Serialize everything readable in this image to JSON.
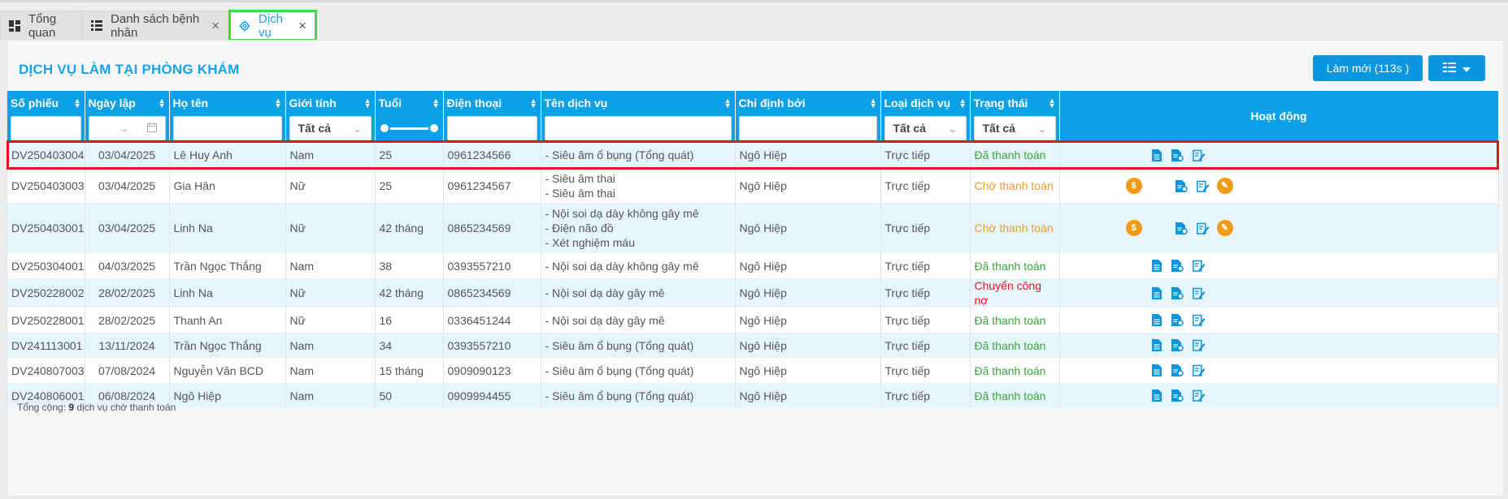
{
  "tabs": [
    {
      "label": "Tổng quan",
      "icon": "dashboard-icon",
      "closable": false
    },
    {
      "label": "Danh sách bệnh nhân",
      "icon": "list-icon",
      "closable": true
    },
    {
      "label": "Dịch vụ",
      "icon": "gear-icon",
      "closable": true,
      "active": true
    }
  ],
  "panel": {
    "title": "DỊCH VỤ LÀM TẠI PHÒNG KHÁM",
    "refresh_label": "Làm mới (113s )"
  },
  "columns": [
    {
      "label": "Số phiếu",
      "filter": "text"
    },
    {
      "label": "Ngày lập",
      "filter": "daterange"
    },
    {
      "label": "Họ tên",
      "filter": "text"
    },
    {
      "label": "Giới tính",
      "filter": "select",
      "value": "Tất cả"
    },
    {
      "label": "Tuổi",
      "filter": "range"
    },
    {
      "label": "Điện thoại",
      "filter": "text"
    },
    {
      "label": "Tên dịch vụ",
      "filter": "text"
    },
    {
      "label": "Chỉ định bởi",
      "filter": "text"
    },
    {
      "label": "Loại dịch vụ",
      "filter": "select",
      "value": "Tất cả"
    },
    {
      "label": "Trạng thái",
      "filter": "select",
      "value": "Tất cả"
    },
    {
      "label": "Hoạt động",
      "filter": "none"
    }
  ],
  "date_separator": "→",
  "rows": [
    {
      "id": "DV250403004",
      "date": "03/04/2025",
      "name": "Lê Huy Anh",
      "gender": "Nam",
      "age": "25",
      "phone": "0961234566",
      "services": [
        "- Siêu âm ổ bụng (Tổng quát)"
      ],
      "doctor": "Ngô Hiệp",
      "type": "Trực tiếp",
      "status": "Đã thanh toán",
      "status_kind": "green",
      "selected": true
    },
    {
      "id": "DV250403003",
      "date": "03/04/2025",
      "name": "Gia Hân",
      "gender": "Nữ",
      "age": "25",
      "phone": "0961234567",
      "services": [
        "- Siêu âm thai",
        "- Siêu âm thai"
      ],
      "doctor": "Ngô Hiệp",
      "type": "Trực tiếp",
      "status": "Chờ thanh toán",
      "status_kind": "orange"
    },
    {
      "id": "DV250403001",
      "date": "03/04/2025",
      "name": "Linh Na",
      "gender": "Nữ",
      "age": "42 tháng",
      "phone": "0865234569",
      "services": [
        "- Nội soi dạ dày không gây mê",
        "- Điện não đồ",
        "- Xét nghiệm máu"
      ],
      "doctor": "Ngô Hiệp",
      "type": "Trực tiếp",
      "status": "Chờ thanh toán",
      "status_kind": "orange"
    },
    {
      "id": "DV250304001",
      "date": "04/03/2025",
      "name": "Trần Ngọc Thắng",
      "gender": "Nam",
      "age": "38",
      "phone": "0393557210",
      "services": [
        "- Nội soi dạ dày không gây mê"
      ],
      "doctor": "Ngô Hiệp",
      "type": "Trực tiếp",
      "status": "Đã thanh toán",
      "status_kind": "green"
    },
    {
      "id": "DV250228002",
      "date": "28/02/2025",
      "name": "Linh Na",
      "gender": "Nữ",
      "age": "42 tháng",
      "phone": "0865234569",
      "services": [
        "- Nội soi dạ dày gây mê"
      ],
      "doctor": "Ngô Hiệp",
      "type": "Trực tiếp",
      "status": "Chuyển công nợ",
      "status_kind": "red"
    },
    {
      "id": "DV250228001",
      "date": "28/02/2025",
      "name": "Thanh An",
      "gender": "Nữ",
      "age": "16",
      "phone": "0336451244",
      "services": [
        "- Nội soi dạ dày gây mê"
      ],
      "doctor": "Ngô Hiệp",
      "type": "Trực tiếp",
      "status": "Đã thanh toán",
      "status_kind": "green"
    },
    {
      "id": "DV241113001",
      "date": "13/11/2024",
      "name": "Trần Ngọc Thắng",
      "gender": "Nam",
      "age": "34",
      "phone": "0393557210",
      "services": [
        "- Siêu âm ổ bụng (Tổng quát)"
      ],
      "doctor": "Ngô Hiệp",
      "type": "Trực tiếp",
      "status": "Đã thanh toán",
      "status_kind": "green"
    },
    {
      "id": "DV240807003",
      "date": "07/08/2024",
      "name": "Nguyễn Văn BCD",
      "gender": "Nam",
      "age": "15 tháng",
      "phone": "0909090123",
      "services": [
        "- Siêu âm ổ bụng (Tổng quát)"
      ],
      "doctor": "Ngô Hiệp",
      "type": "Trực tiếp",
      "status": "Đã thanh toán",
      "status_kind": "green"
    },
    {
      "id": "DV240806001",
      "date": "06/08/2024",
      "name": "Ngô Hiệp",
      "gender": "Nam",
      "age": "50",
      "phone": "0909994455",
      "services": [
        "- Siêu âm ổ bụng (Tổng quát)"
      ],
      "doctor": "Ngô Hiệp",
      "type": "Trực tiếp",
      "status": "Đã thanh toán",
      "status_kind": "green"
    }
  ],
  "footer": {
    "prefix": "Tổng cộng: ",
    "count": "9",
    "suffix": " dịch vụ chờ thanh toán"
  },
  "colors": {
    "accent": "#0ba0e8",
    "paid": "#3da53d",
    "pending": "#f39a2d",
    "debt": "#e8151d",
    "action_orange": "#f39a12"
  }
}
